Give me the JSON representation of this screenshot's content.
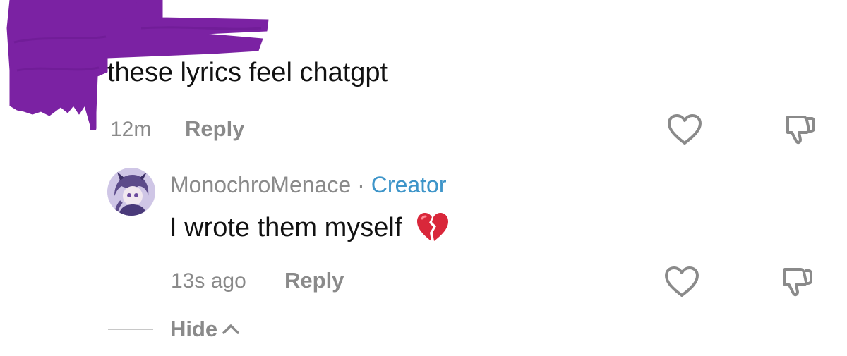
{
  "first_comment": {
    "text": "these lyrics feel chatgpt",
    "timestamp": "12m",
    "reply_label": "Reply",
    "like_icon": "heart-outline-icon",
    "dislike_icon": "thumbs-down-outline-icon"
  },
  "reply_comment": {
    "author": "MonochroMenace",
    "separator": "·",
    "badge": "Creator",
    "text": "I wrote them myself",
    "emoji_icon": "broken-heart-icon",
    "timestamp": "13s ago",
    "reply_label": "Reply",
    "like_icon": "heart-outline-icon",
    "dislike_icon": "thumbs-down-outline-icon"
  },
  "thread_controls": {
    "hide_label": "Hide",
    "hide_icon": "chevron-up-icon"
  },
  "colors": {
    "text_primary": "#111111",
    "text_muted": "#8a8a8a",
    "creator_badge": "#3e95c9",
    "redaction_scribble": "#7b22a3",
    "broken_heart": "#d9273a"
  }
}
